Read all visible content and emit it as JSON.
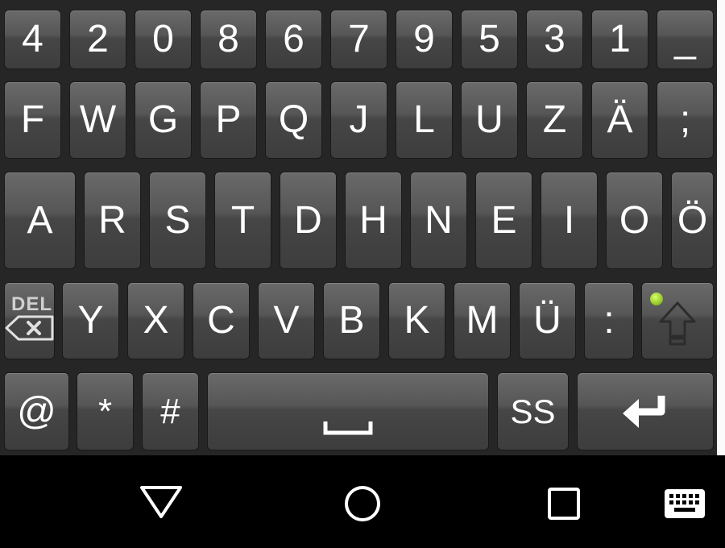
{
  "keyboard": {
    "row1": [
      "4",
      "2",
      "0",
      "8",
      "6",
      "7",
      "9",
      "5",
      "3",
      "1",
      "_"
    ],
    "row2": [
      "F",
      "W",
      "G",
      "P",
      "Q",
      "J",
      "L",
      "U",
      "Z",
      "Ä",
      ";"
    ],
    "row3": [
      "A",
      "R",
      "S",
      "T",
      "D",
      "H",
      "N",
      "E",
      "I",
      "O",
      "Ö"
    ],
    "row4": [
      "Y",
      "X",
      "C",
      "V",
      "B",
      "K",
      "M",
      "Ü",
      ":"
    ],
    "row5": [
      "@",
      "*",
      "#"
    ],
    "delete_label": "DEL",
    "ss_label": "SS",
    "space_icon": "space-bar-icon",
    "enter_icon": "enter-arrow-icon",
    "shift_icon": "shift-arrow-icon",
    "shift_indicator_color": "#8cc020"
  },
  "navbar": {
    "back_icon": "back-triangle-icon",
    "home_icon": "home-circle-icon",
    "recents_icon": "recents-square-icon",
    "keyboard_icon": "keyboard-icon"
  },
  "colors": {
    "keyboard_bg": "#262626",
    "key_top": "#6a6a6a",
    "key_bottom": "#3d3d3d",
    "navbar_bg": "#000000"
  }
}
